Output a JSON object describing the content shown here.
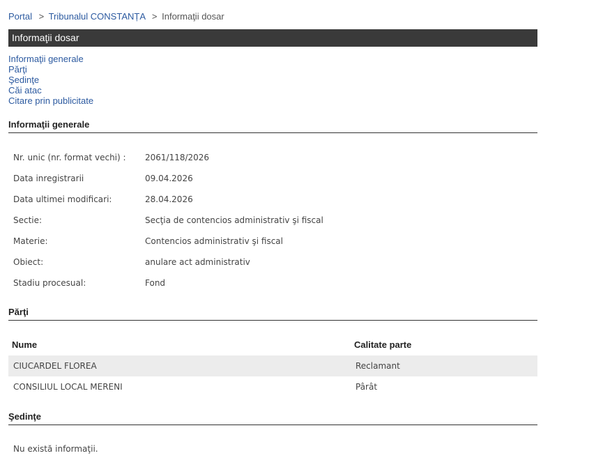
{
  "breadcrumb": {
    "portal": "Portal",
    "sep1": ">",
    "court": "Tribunalul CONSTANȚA",
    "sep2": ">",
    "current": "Informaţii dosar"
  },
  "page_title": "Informaţii dosar",
  "toc": [
    "Informaţii generale",
    "Părţi",
    "Şedinţe",
    "Căi atac",
    "Citare prin publicitate"
  ],
  "general": {
    "heading": "Informaţii generale",
    "rows": [
      {
        "label": "Nr. unic (nr. format vechi) :",
        "value": "2061/118/2026"
      },
      {
        "label": "Data inregistrarii",
        "value": "09.04.2026"
      },
      {
        "label": "Data ultimei modificari:",
        "value": "28.04.2026"
      },
      {
        "label": "Sectie:",
        "value": "Secţia de contencios administrativ şi fiscal"
      },
      {
        "label": "Materie:",
        "value": "Contencios administrativ şi fiscal"
      },
      {
        "label": "Obiect:",
        "value": "anulare act administrativ"
      },
      {
        "label": "Stadiu procesual:",
        "value": "Fond"
      }
    ]
  },
  "parti": {
    "heading": "Părţi",
    "col_name": "Nume",
    "col_role": "Calitate parte",
    "rows": [
      {
        "name": "CIUCARDEL FLOREA",
        "role": "Reclamant"
      },
      {
        "name": "CONSILIUL LOCAL MERENI",
        "role": "Pârât"
      }
    ]
  },
  "sedinte": {
    "heading": "Şedinţe",
    "empty": "Nu există informaţii."
  }
}
